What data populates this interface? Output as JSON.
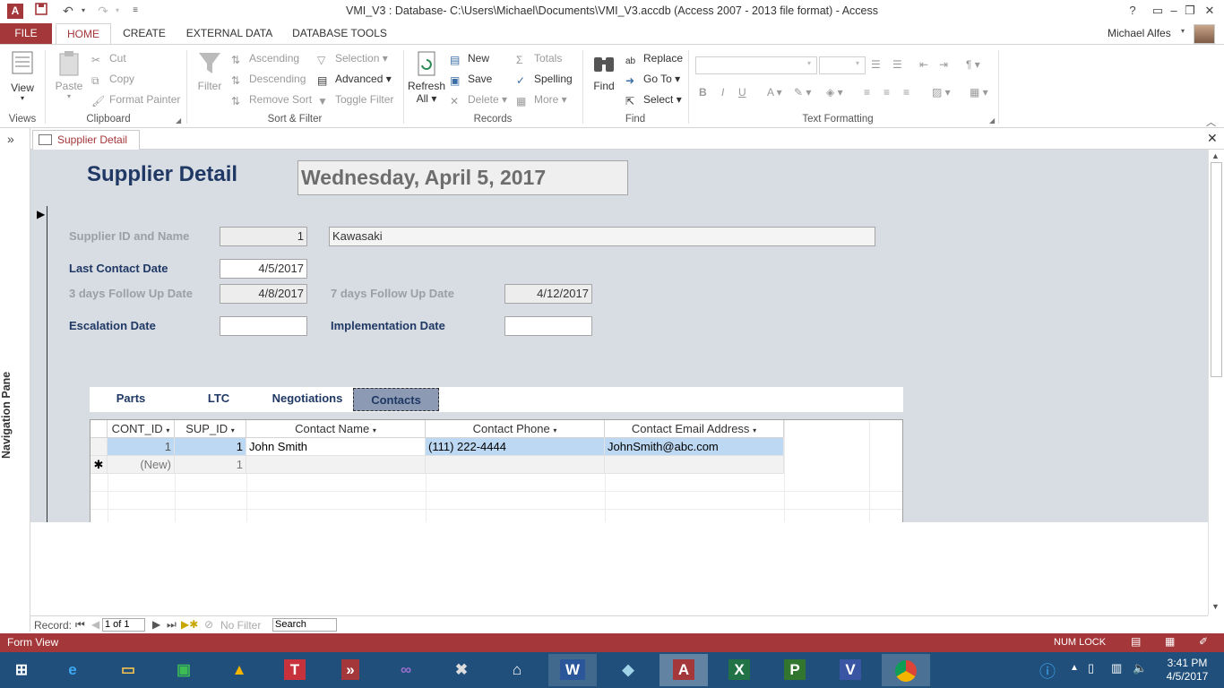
{
  "window": {
    "title": "VMI_V3 : Database- C:\\Users\\Michael\\Documents\\VMI_V3.accdb (Access 2007 - 2013 file format) - Access",
    "help": "?",
    "app_icon": "A"
  },
  "ribbon": {
    "tabs": [
      "FILE",
      "HOME",
      "CREATE",
      "EXTERNAL DATA",
      "DATABASE TOOLS"
    ],
    "user": "Michael Alfes",
    "groups": {
      "views": {
        "label": "Views",
        "view": "View"
      },
      "clipboard": {
        "label": "Clipboard",
        "paste": "Paste",
        "cut": "Cut",
        "copy": "Copy",
        "format_painter": "Format Painter"
      },
      "sort_filter": {
        "label": "Sort & Filter",
        "filter": "Filter",
        "ascending": "Ascending",
        "descending": "Descending",
        "remove_sort": "Remove Sort",
        "selection": "Selection",
        "advanced": "Advanced",
        "toggle_filter": "Toggle Filter"
      },
      "records": {
        "label": "Records",
        "refresh": "Refresh",
        "refresh_all": "All",
        "new": "New",
        "save": "Save",
        "delete": "Delete",
        "totals": "Totals",
        "spelling": "Spelling",
        "more": "More"
      },
      "find": {
        "label": "Find",
        "find": "Find",
        "replace": "Replace",
        "goto": "Go To",
        "select": "Select"
      },
      "text_formatting": {
        "label": "Text Formatting",
        "bold": "B",
        "italic": "I",
        "underline": "U"
      }
    }
  },
  "doc_tab": {
    "label": "Supplier Detail"
  },
  "nav_pane": {
    "label": "Navigation Pane",
    "toggle": "»"
  },
  "form": {
    "title": "Supplier Detail",
    "date": "Wednesday, April 5, 2017",
    "supplier_label": "Supplier ID and Name",
    "supplier_id": "1",
    "supplier_name": "Kawasaki",
    "last_contact_label": "Last Contact Date",
    "last_contact": "4/5/2017",
    "followup3_label": "3 days Follow Up Date",
    "followup3": "4/8/2017",
    "followup7_label": "7 days Follow Up Date",
    "followup7": "4/12/2017",
    "escalation_label": "Escalation Date",
    "escalation": "",
    "implementation_label": "Implementation Date",
    "implementation": ""
  },
  "subform": {
    "tabs": [
      "Parts",
      "LTC",
      "Negotiations",
      "Contacts"
    ],
    "active_tab": "Contacts",
    "columns": [
      "CONT_ID",
      "SUP_ID",
      "Contact Name",
      "Contact Phone",
      "Contact Email Address"
    ],
    "rows": [
      {
        "cont_id": "1",
        "sup_id": "1",
        "name": "John Smith",
        "phone": "(111) 222-4444",
        "email": "JohnSmith@abc.com"
      }
    ],
    "new_row": {
      "marker": "✱",
      "cont_id": "(New)",
      "sup_id": "1"
    }
  },
  "record_nav": {
    "label": "Record:",
    "position": "1 of 1",
    "filter": "No Filter",
    "search": "Search"
  },
  "status": {
    "mode": "Form View",
    "numlock": "NUM LOCK"
  },
  "taskbar": {
    "time": "3:41 PM",
    "date": "4/5/2017"
  },
  "colors": {
    "accent": "#a4373a",
    "form_bg": "#d8dce3",
    "label_blue": "#1f3864",
    "selected_row": "#bcd8f2"
  }
}
